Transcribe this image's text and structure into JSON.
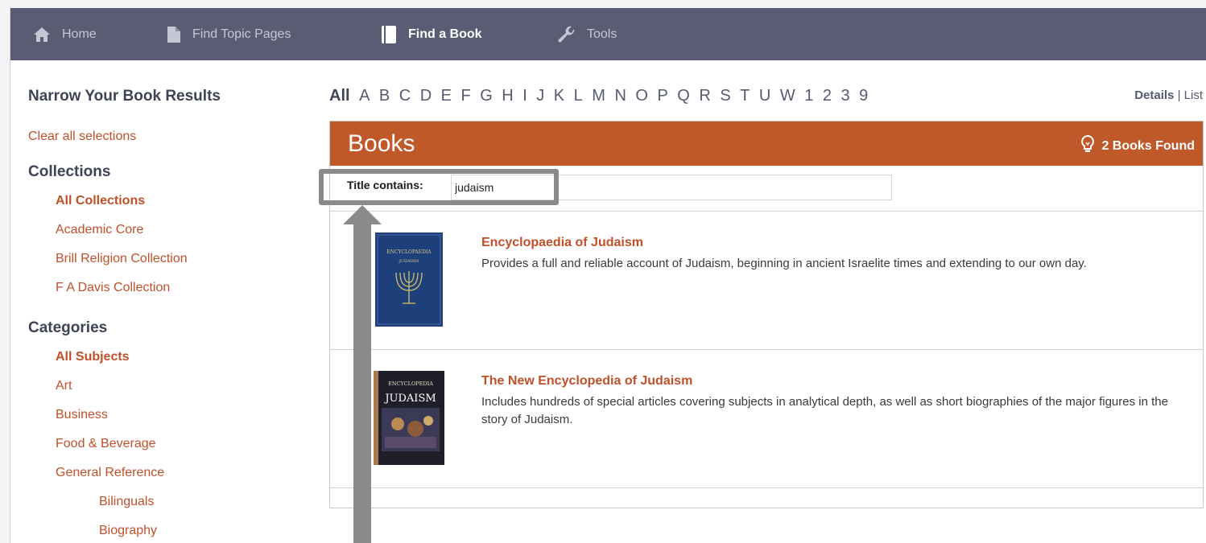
{
  "nav": {
    "items": [
      {
        "label": "Home",
        "icon": "home-icon"
      },
      {
        "label": "Find Topic Pages",
        "icon": "document-icon"
      },
      {
        "label": "Find a Book",
        "icon": "book-icon"
      },
      {
        "label": "Tools",
        "icon": "wrench-icon"
      }
    ],
    "active": "Find a Book"
  },
  "sidebar": {
    "title": "Narrow Your Book Results",
    "clear_label": "Clear all selections",
    "collections_heading": "Collections",
    "collections": [
      {
        "label": "All Collections",
        "selected": true
      },
      {
        "label": "Academic Core"
      },
      {
        "label": "Brill Religion Collection"
      },
      {
        "label": "F A Davis Collection"
      }
    ],
    "categories_heading": "Categories",
    "categories": [
      {
        "label": "All Subjects",
        "selected": true
      },
      {
        "label": "Art"
      },
      {
        "label": "Business"
      },
      {
        "label": "Food & Beverage"
      },
      {
        "label": "General Reference"
      },
      {
        "label": "Bilinguals",
        "sub": true
      },
      {
        "label": "Biography",
        "sub": true
      }
    ]
  },
  "alphabet": [
    "All",
    "A",
    "B",
    "C",
    "D",
    "E",
    "F",
    "G",
    "H",
    "I",
    "J",
    "K",
    "L",
    "M",
    "N",
    "O",
    "P",
    "Q",
    "R",
    "S",
    "T",
    "U",
    "W",
    "1",
    "2",
    "3",
    "9"
  ],
  "view": {
    "details_label": "Details",
    "separator": "|",
    "list_label": "List"
  },
  "results": {
    "title": "Books",
    "found_label": "2 Books Found",
    "filter_label": "Title contains:",
    "filter_value": "judaism",
    "books": [
      {
        "title": "Encyclopaedia of Judaism",
        "description": "Provides a full and reliable account of Judaism, beginning in ancient Israelite times and extending to our own day.",
        "cover_text": [
          "ENCYCLOPAEDIA",
          "JUDAISM"
        ]
      },
      {
        "title": "The New Encyclopedia of Judaism",
        "description": "Includes hundreds of special articles covering subjects in analytical depth, as well as short biographies of the major figures in the story of Judaism.",
        "cover_text": [
          "ENCYCLOPEDIA",
          "JUDAISM"
        ]
      }
    ]
  },
  "colors": {
    "nav_bg": "#5a5c74",
    "accent": "#c0592a",
    "link": "#c0502a",
    "annotation": "#8a8a8a"
  }
}
